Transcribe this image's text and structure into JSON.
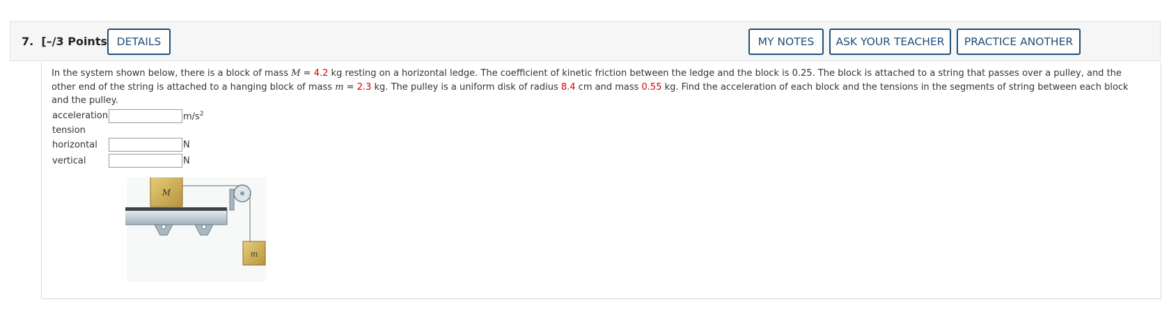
{
  "header": {
    "question_number": "7.",
    "points": "[–/3 Points]",
    "details_label": "DETAILS",
    "my_notes_label": "MY NOTES",
    "ask_teacher_label": "ASK YOUR TEACHER",
    "practice_label": "PRACTICE ANOTHER"
  },
  "problem": {
    "t1": "In the system shown below, there is a block of mass ",
    "M_sym": "M",
    "eq1": " = ",
    "M_val": "4.2",
    "t2": " kg resting on a horizontal ledge. The coefficient of kinetic friction between the ledge and the block is 0.25. The block is attached to a string that passes over a pulley, and the other end of the string is attached to a hanging block of mass ",
    "m_sym": "m",
    "eq2": " = ",
    "m_val": "2.3",
    "t3": " kg. The pulley is a uniform disk of radius ",
    "r_val": "8.4",
    "t4": " cm and mass ",
    "mp_val": "0.55",
    "t5": " kg. Find the acceleration of each block and the tensions in the segments of string between each block and the pulley."
  },
  "answers": {
    "acceleration_label": "acceleration",
    "acceleration_value": "",
    "acceleration_unit": "m/s",
    "acceleration_unit_exp": "2",
    "tension_label": "tension",
    "horizontal_label": "horizontal",
    "horizontal_value": "",
    "horizontal_unit": "N",
    "vertical_label": "vertical",
    "vertical_value": "",
    "vertical_unit": "N"
  },
  "figure": {
    "big_block_label": "M",
    "small_block_label": "m",
    "colors": {
      "block": "#c9a94a",
      "ledge": "#b7c3cc"
    }
  }
}
